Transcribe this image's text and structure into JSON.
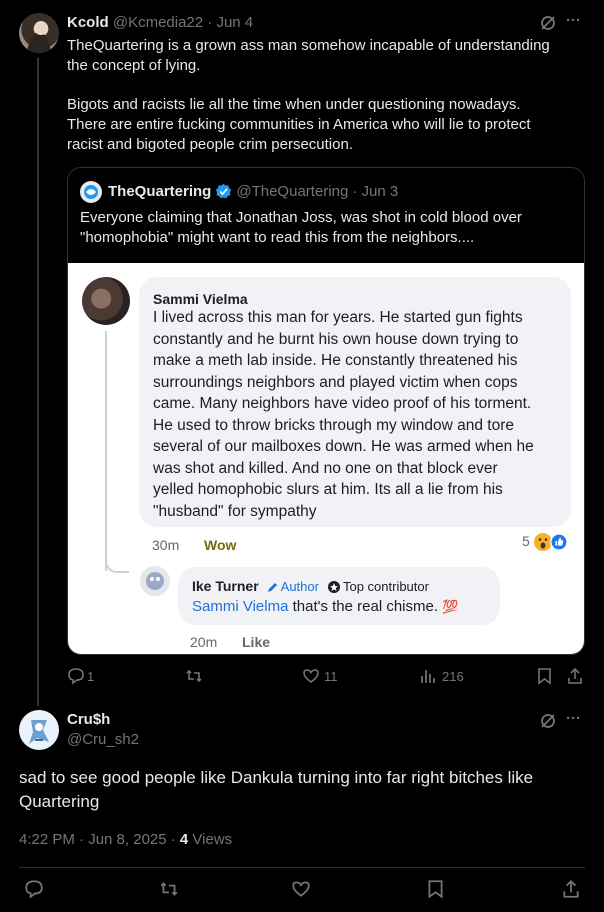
{
  "tweet1": {
    "display_name": "Kcold",
    "handle": "@Kcmedia22",
    "date": "· Jun 4",
    "text_p1_l1": "TheQuartering is a grown ass man somehow incapable of understanding",
    "text_p1_l2": "the concept of lying.",
    "text_p2_l1": "Bigots and racists lie all the time when under questioning nowadays.",
    "text_p2_l2": "There are entire fucking communities in America who will lie to protect",
    "text_p2_l3": "racist and bigoted people crim persecution.",
    "more": "···",
    "actions": {
      "replies": "1",
      "reposts": "",
      "likes": "11",
      "views": "216"
    }
  },
  "quote": {
    "display_name": "TheQuartering",
    "handle": "@TheQuartering",
    "date": "· Jun 3",
    "text_l1": "Everyone claiming that Jonathan Joss, was shot in cold blood over",
    "text_l2": "\"homophobia\" might want to read this from the neighbors....",
    "screenshot": {
      "commenter": "Sammi Vielma",
      "comment_lines": [
        "I lived across this man for years. He started gun fights",
        "constantly and he burnt his own house down trying to",
        "make a meth lab inside. He constantly threatened his",
        "surroundings neighbors and played victim when cops",
        "came. Many neighbors have video proof of his torment.",
        "He used to throw bricks through my window and tore",
        "several of our mailboxes down. He was armed when he",
        "was shot and killed. And no one on that block ever",
        "yelled homophobic slurs at him. Its all a lie from his",
        "\"husband\" for sympathy"
      ],
      "comment_time": "30m",
      "reaction_label": "Wow",
      "reaction_count": "5",
      "reply_name": "Ike Turner",
      "author_badge": "Author",
      "contributor_badge": "Top contributor",
      "reply_mention": "Sammi Vielma",
      "reply_text": " that's the real chisme.",
      "reply_emoji": "💯",
      "reply_time": "20m",
      "reply_like": "Like"
    }
  },
  "tweet2": {
    "display_name": "Cru$h",
    "handle": "@Cru_sh2",
    "more": "···",
    "text_l1": "sad to see good people like Dankula turning into far right bitches like",
    "text_l2": "Quartering",
    "timestamp": "4:22 PM · Jun 8, 2025 · ",
    "views_count": "4",
    "views_label": " Views"
  },
  "colors": {
    "background": "#000000",
    "text": "#e7e9ea",
    "muted": "#71767b",
    "verified": "#1d9bf0",
    "facebook_link": "#216fdb"
  }
}
